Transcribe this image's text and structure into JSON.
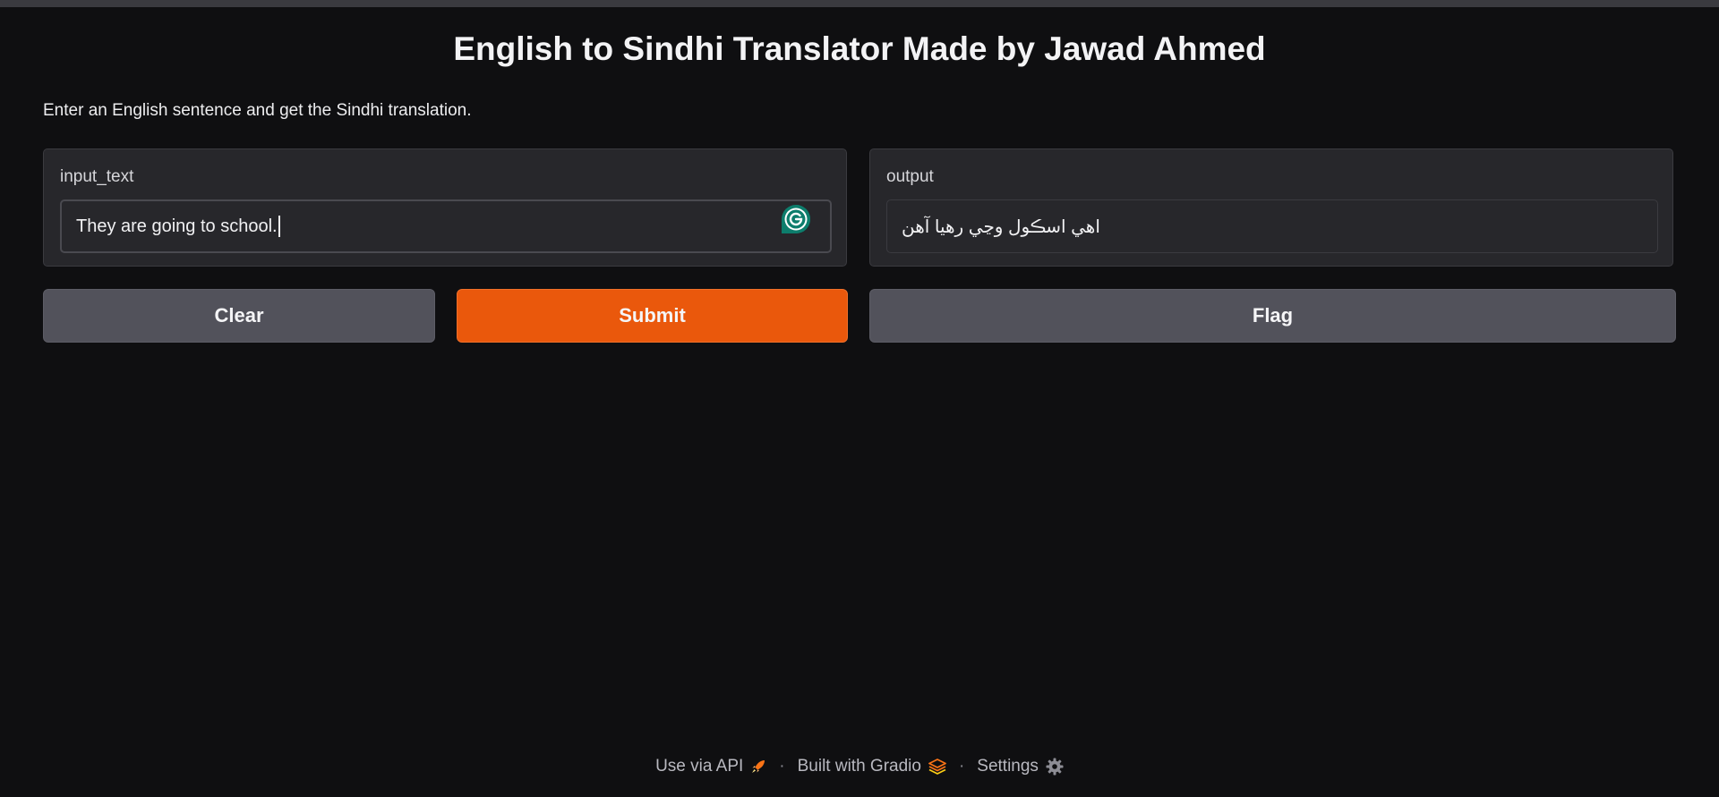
{
  "app": {
    "title": "English to Sindhi Translator Made by Jawad Ahmed",
    "description": "Enter an English sentence and get the Sindhi translation."
  },
  "input": {
    "label": "input_text",
    "value": "They are going to school."
  },
  "output": {
    "label": "output",
    "value": "اهي اسڪول وڃي رهيا آهن"
  },
  "buttons": {
    "clear": "Clear",
    "submit": "Submit",
    "flag": "Flag"
  },
  "footer": {
    "api": "Use via API",
    "separator": "·",
    "built": "Built with Gradio",
    "settings": "Settings"
  },
  "icons": {
    "grammarly": "grammarly-icon",
    "api": "rocket-icon",
    "gradio": "gradio-logo-icon",
    "settings": "gear-icon"
  },
  "colors": {
    "background": "#0f0f11",
    "panel": "#27272b",
    "submit": "#ea580c",
    "secondary_button": "#52525b",
    "grammarly": "#15c39a"
  }
}
